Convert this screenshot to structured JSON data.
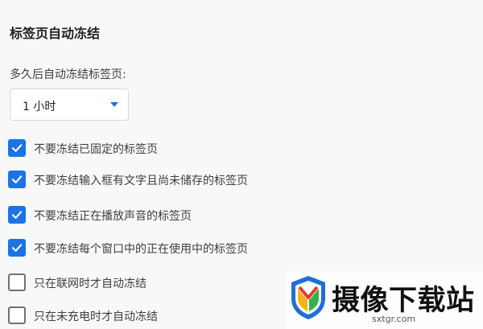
{
  "section": {
    "title": "标签页自动冻结"
  },
  "freeze_delay": {
    "label": "多久后自动冻结标签页:",
    "selected": "1 小时"
  },
  "options": [
    {
      "label": "不要冻结已固定的标签页",
      "checked": true
    },
    {
      "label": "不要冻结输入框有文字且尚未储存的标签页",
      "checked": true
    },
    {
      "label": "不要冻结正在播放声音的标签页",
      "checked": true
    },
    {
      "label": "不要冻结每个窗口中的正在使用中的标签页",
      "checked": true
    },
    {
      "label": "只在联网时才自动冻结",
      "checked": false
    },
    {
      "label": "只在未充电时才自动冻结",
      "checked": false
    }
  ],
  "watermark": {
    "brand": "摄像下载站",
    "domain": "sxtgr.com"
  },
  "colors": {
    "accent": "#1a73e8",
    "background": "#f8f8f9",
    "unchecked_border": "#6d7278"
  },
  "icons": {
    "checkmark": "check-icon",
    "dropdown": "caret-down-icon",
    "logo": "download-site-logo"
  }
}
